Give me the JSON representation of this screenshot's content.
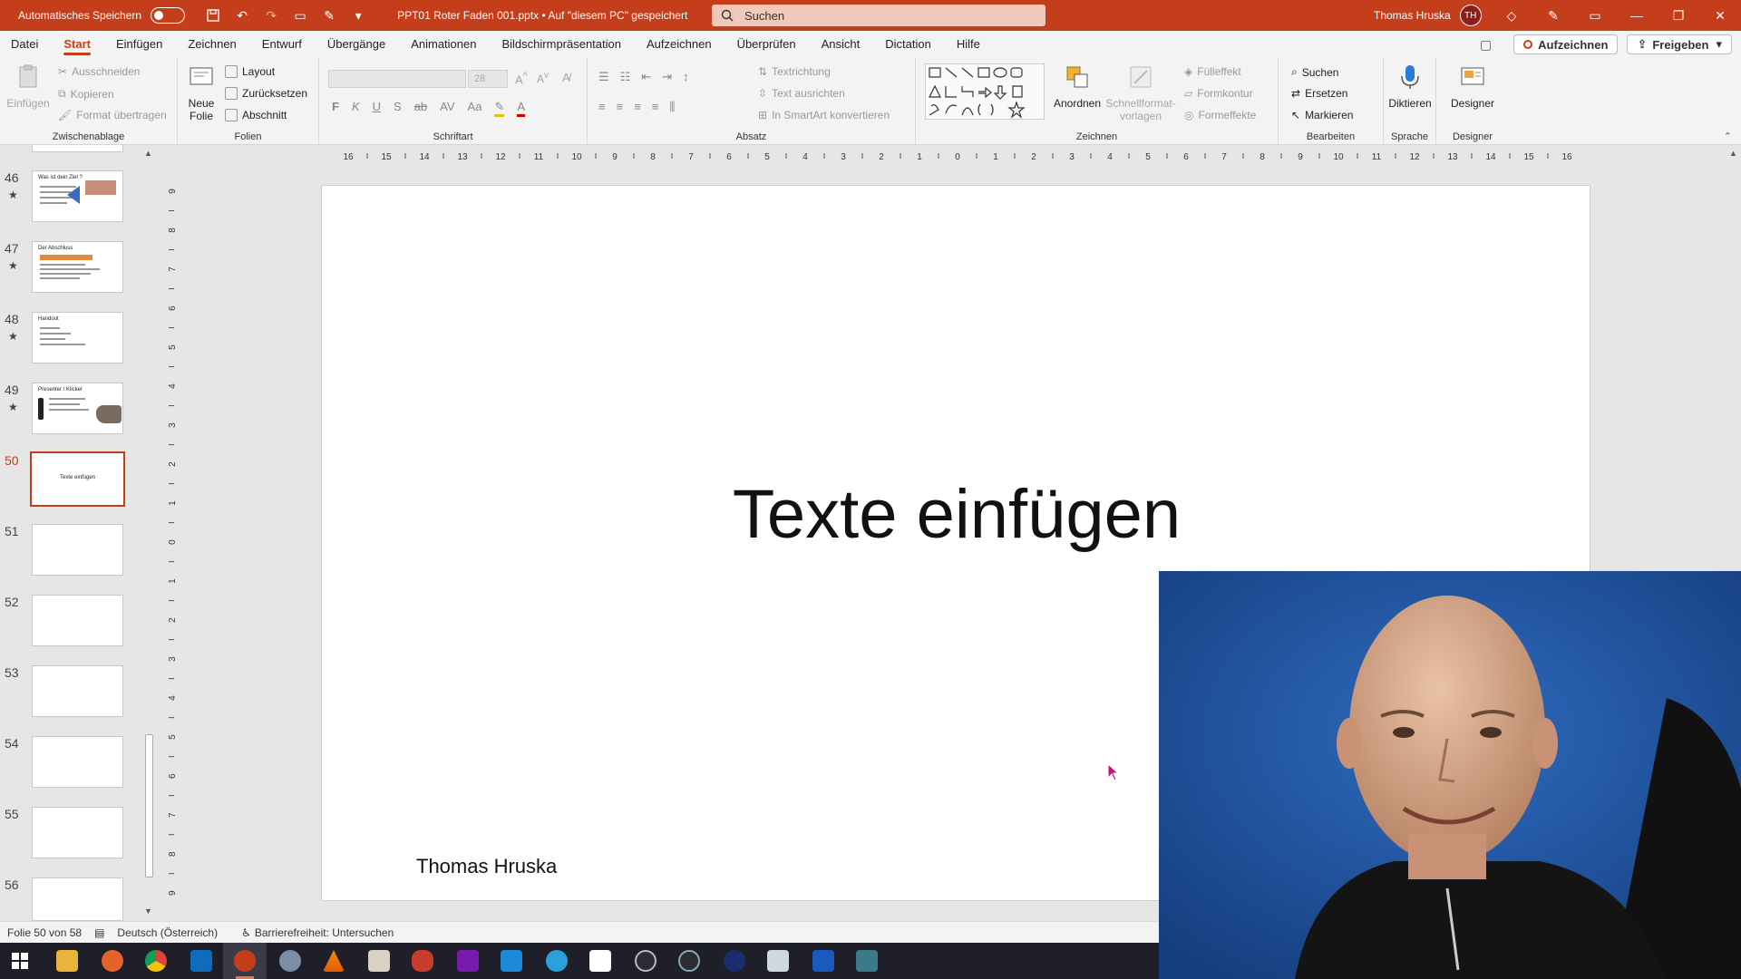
{
  "titlebar": {
    "autosave_label": "Automatisches Speichern",
    "filename": "PPT01 Roter Faden 001.pptx • Auf \"diesem PC\" gespeichert",
    "search_placeholder": "Suchen",
    "user_name": "Thomas Hruska",
    "user_initials": "TH"
  },
  "menu": {
    "tabs": [
      "Datei",
      "Start",
      "Einfügen",
      "Zeichnen",
      "Entwurf",
      "Übergänge",
      "Animationen",
      "Bildschirmpräsentation",
      "Aufzeichnen",
      "Überprüfen",
      "Ansicht",
      "Dictation",
      "Hilfe"
    ],
    "record_label": "Aufzeichnen",
    "share_label": "Freigeben"
  },
  "ribbon": {
    "clipboard": {
      "label": "Zwischenablage",
      "paste": "Einfügen",
      "cut": "Ausschneiden",
      "copy": "Kopieren",
      "format_painter": "Format übertragen"
    },
    "slides": {
      "label": "Folien",
      "new_slide_1": "Neue",
      "new_slide_2": "Folie",
      "layout": "Layout",
      "reset": "Zurücksetzen",
      "section": "Abschnitt"
    },
    "font": {
      "label": "Schriftart",
      "size": "28",
      "bold": "F",
      "italic": "K",
      "underline": "U",
      "shadow": "S",
      "strike": "ab",
      "spacing": "AV",
      "case": "Aa"
    },
    "paragraph": {
      "label": "Absatz",
      "text_direction": "Textrichtung",
      "align_text": "Text ausrichten",
      "smartart": "In SmartArt konvertieren"
    },
    "drawing": {
      "label": "Zeichnen",
      "arrange": "Anordnen",
      "quick_styles_1": "Schnellformat-",
      "quick_styles_2": "vorlagen",
      "fill": "Fülleffekt",
      "outline": "Formkontur",
      "effects": "Formeffekte"
    },
    "editing": {
      "label": "Bearbeiten",
      "find": "Suchen",
      "replace": "Ersetzen",
      "select": "Markieren"
    },
    "voice": {
      "label": "Sprache",
      "dictate": "Diktieren"
    },
    "designer": {
      "label": "Designer",
      "designer": "Designer"
    }
  },
  "thumbnails": [
    {
      "num": "46",
      "star": "★",
      "title": "Was ist dein Ziel ?"
    },
    {
      "num": "47",
      "star": "★",
      "title": "Der Abschluss"
    },
    {
      "num": "48",
      "star": "★",
      "title": "Handout"
    },
    {
      "num": "49",
      "star": "★",
      "title": "Presenter / Klicker"
    },
    {
      "num": "50",
      "star": "",
      "title": "Texte einfügen"
    },
    {
      "num": "51",
      "star": "",
      "title": ""
    },
    {
      "num": "52",
      "star": "",
      "title": ""
    },
    {
      "num": "53",
      "star": "",
      "title": ""
    },
    {
      "num": "54",
      "star": "",
      "title": ""
    },
    {
      "num": "55",
      "star": "",
      "title": ""
    },
    {
      "num": "56",
      "star": "",
      "title": ""
    }
  ],
  "slide": {
    "title": "Texte einfügen",
    "author": "Thomas Hruska"
  },
  "ruler": {
    "h_ticks": [
      "16",
      "15",
      "14",
      "13",
      "12",
      "11",
      "10",
      "9",
      "8",
      "7",
      "6",
      "5",
      "4",
      "3",
      "2",
      "1",
      "0",
      "1",
      "2",
      "3",
      "4",
      "5",
      "6",
      "7",
      "8",
      "9",
      "10",
      "11",
      "12",
      "13",
      "14",
      "15",
      "16"
    ]
  },
  "status": {
    "slide_counter": "Folie 50 von 58",
    "language": "Deutsch (Österreich)",
    "accessibility": "Barrierefreiheit: Untersuchen"
  },
  "colors": {
    "accent": "#c43e1c",
    "taskbar": "#1f1f2a"
  }
}
